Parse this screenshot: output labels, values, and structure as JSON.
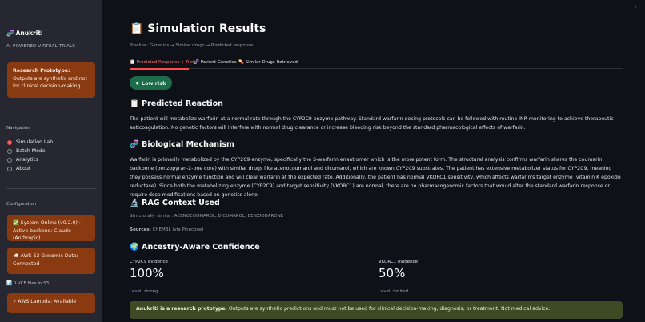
{
  "sidebar": {
    "brand": "Anukriti",
    "brand_icon": "dna-icon",
    "subtitle": "AI-POWERED VIRTUAL TRIALS",
    "prototype_alert": {
      "bold": "Research Prototype:",
      "text": " Outputs are synthetic and not for clinical decision-making."
    },
    "navigation_title": "Navigation",
    "nav_items": [
      {
        "label": "Simulation Lab",
        "selected": true
      },
      {
        "label": "Batch Mode",
        "selected": false
      },
      {
        "label": "Analytics",
        "selected": false
      },
      {
        "label": "About",
        "selected": false
      }
    ],
    "configuration_title": "Configuration",
    "status_cards": [
      "✅ System Online (v0.2.0) · Active backend: Claude (Anthropic)",
      "☁️ AWS S3 Genomic Data: Connected"
    ],
    "vcf_note": "📊 0 VCF files in S3",
    "lambda_card": "⚡ AWS Lambda: Available"
  },
  "topbar": {
    "menu_icon": "⋮"
  },
  "main": {
    "title": "📋 Simulation Results",
    "breadcrumb": "Pipeline: Genetics → Similar drugs → Predicted response",
    "tabs": [
      "📋 Predicted Response + Risk",
      "🧬 Patient Genetics",
      "💊 Similar Drugs Retrieved"
    ],
    "risk_badge": "Low risk",
    "reaction_heading": "📋 Predicted Reaction",
    "reaction_text": "The patient will metabolize warfarin at a normal rate through the CYP2C9 enzyme pathway. Standard warfarin dosing protocols can be followed with routine INR monitoring to achieve therapeutic anticoagulation. No genetic factors will interfere with normal drug clearance or increase bleeding risk beyond the standard pharmacological effects of warfarin.",
    "mechanism_heading": "🧬 Biological Mechanism",
    "mechanism_text": "Warfarin is primarily metabolized by the CYP2C9 enzyme, specifically the S-warfarin enantiomer which is the more potent form. The structural analysis confirms warfarin shares the coumarin backbone (benzopyran-2-one core) with similar drugs like acenocoumarol and dicumarol, which are known CYP2C9 substrates. The patient has extensive metabolizer status for CYP2C9, meaning they possess normal enzyme function and will clear warfarin at the expected rate. Additionally, the patient has normal VKORC1 sensitivity, which affects warfarin's target enzyme (vitamin K epoxide reductase). Since both the metabolizing enzyme (CYP2C9) and target sensitivity (VKORC1) are normal, there are no pharmacogenomic factors that would alter the standard warfarin response or require dose modifications based on genetics alone.",
    "rag_heading": "🔬 RAG Context Used",
    "rag_similar": "Structurally similar: ACENOCOUMAROL, DICUMAROL, BENZIODARONE",
    "rag_sources_label": "Sources:",
    "rag_sources_value": " CHEMBL (via Pinecone)",
    "confidence_heading": "🌍 Ancestry-Aware Confidence",
    "metrics": [
      {
        "label": "CYP2C9 evidence",
        "value": "100%",
        "level": "Level: strong"
      },
      {
        "label": "VKORC1 evidence",
        "value": "50%",
        "level": "Level: limited"
      }
    ],
    "disclaimer_bold": "Anukriti is a research prototype.",
    "disclaimer_text": " Outputs are synthetic predictions and must not be used for clinical decision-making, diagnosis, or treatment. Not medical advice."
  }
}
